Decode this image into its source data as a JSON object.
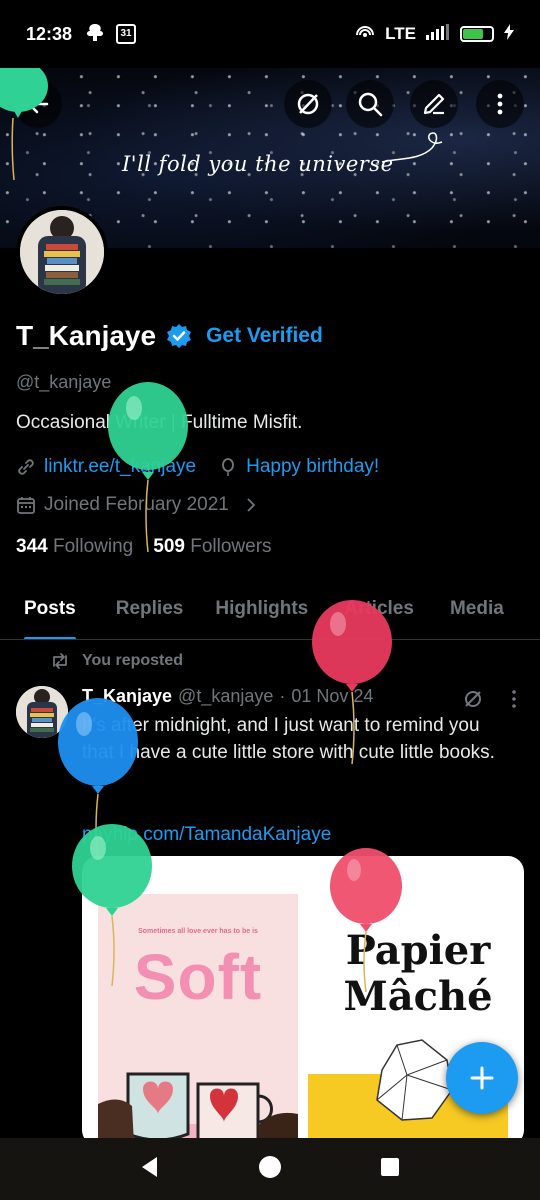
{
  "status_bar": {
    "time": "12:38",
    "calendar_day": "31",
    "network": "LTE",
    "battery_level": 0.7
  },
  "banner": {
    "text": "I'll fold you the universe"
  },
  "profile": {
    "name": "T_Kanjaye",
    "get_verified": "Get Verified",
    "handle": "@t_kanjaye",
    "bio": "Occasional Writer | Fulltime Misfit.",
    "link": "linktr.ee/t_kanjaye",
    "birthday": "Happy birthday!",
    "joined": "Joined February 2021",
    "following_count": "344",
    "following_label": "Following",
    "followers_count": "509",
    "followers_label": "Followers"
  },
  "tabs": [
    "Posts",
    "Replies",
    "Highlights",
    "Articles",
    "Media"
  ],
  "post": {
    "repost_label": "You reposted",
    "author": "T_Kanjaye",
    "handle": "@t_kanjaye",
    "separator": "·",
    "date": "01 Nov 24",
    "text": "It's after midnight, and I just want to remind you that I have a cute little store with cute little books.",
    "link": "payhip.com/TamandaKanjaye",
    "media": {
      "left_tagline": "Sometimes all love ever has to be is",
      "left_title": "Soft",
      "right_title_line1": "Papier",
      "right_title_line2": "Mâché"
    }
  },
  "colors": {
    "accent": "#1d9bf0",
    "background": "#000000",
    "muted": "#71767b"
  }
}
